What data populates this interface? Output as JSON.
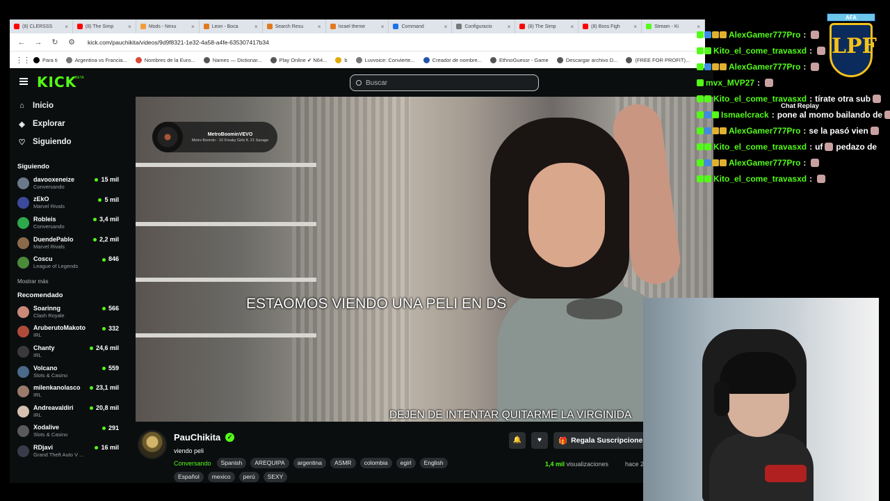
{
  "browser": {
    "tabs": [
      {
        "label": "(8) CLERSSS",
        "color": "#ff0000"
      },
      {
        "label": "(8) The Simp",
        "color": "#ff0000"
      },
      {
        "label": "Mods - Nexu",
        "color": "#f29d38"
      },
      {
        "label": "Leon - Boca",
        "color": "#e07a1f"
      },
      {
        "label": "Search Resu",
        "color": "#e07a1f"
      },
      {
        "label": "Israel theme",
        "color": "#e07a1f"
      },
      {
        "label": "Command",
        "color": "#1a73e8"
      },
      {
        "label": "Configuracio",
        "color": "#777777"
      },
      {
        "label": "(8) The Simp",
        "color": "#ff0000"
      },
      {
        "label": "(8) Boss Figh",
        "color": "#ff0000"
      },
      {
        "label": "Stream - Ki",
        "color": "#53fc18"
      }
    ],
    "url": "kick.com/pauchikita/videos/9d9f8321-1e32-4a58-a4fe-635307417b34",
    "bookmarks": [
      {
        "label": "Para ti",
        "color": "#000000"
      },
      {
        "label": "Argentina vs Francia...",
        "color": "#777777"
      },
      {
        "label": "Nombres de la Euro...",
        "color": "#d94a38"
      },
      {
        "label": "Names — Dictionar...",
        "color": "#555555"
      },
      {
        "label": "Play Online ✔ N64...",
        "color": "#555555"
      },
      {
        "label": "b",
        "color": "#e0a800"
      },
      {
        "label": "Luvvoice: Convierte...",
        "color": "#777777"
      },
      {
        "label": "Creador de nombre...",
        "color": "#2255aa"
      },
      {
        "label": "EthnoGuessr - Game",
        "color": "#555555"
      },
      {
        "label": "Descargar archivo D...",
        "color": "#555555"
      },
      {
        "label": "(FREE FOR PROFIT)...",
        "color": "#555555"
      }
    ]
  },
  "kick": {
    "logo": "KICK",
    "logo_beta": "BETA",
    "search_placeholder": "Buscar",
    "nav": [
      {
        "icon": "⌂",
        "label": "Inicio"
      },
      {
        "icon": "◈",
        "label": "Explorar"
      },
      {
        "icon": "♡",
        "label": "Siguiendo"
      }
    ],
    "following_title": "Siguiendo",
    "following": [
      {
        "name": "davooxeneize",
        "category": "Conversando",
        "viewers": "15 mil",
        "color": "#6b7a8a"
      },
      {
        "name": "zEkO",
        "category": "Marvel Rivals",
        "viewers": "5 mil",
        "color": "#3b4a9a"
      },
      {
        "name": "Robleis",
        "category": "Conversando",
        "viewers": "3,4 mil",
        "color": "#2da84a"
      },
      {
        "name": "DuendePablo",
        "category": "Marvel Rivals",
        "viewers": "2,2 mil",
        "color": "#8a6a4a"
      },
      {
        "name": "Coscu",
        "category": "League of Legends",
        "viewers": "846",
        "color": "#4a8a3a"
      }
    ],
    "show_more": "Mostrar más",
    "recommended_title": "Recomendado",
    "recommended": [
      {
        "name": "Soarinng",
        "category": "Clash Royale",
        "viewers": "566",
        "color": "#c98a7a"
      },
      {
        "name": "AruberutoMakoto",
        "category": "IRL",
        "viewers": "332",
        "color": "#b04a3a"
      },
      {
        "name": "Chanty",
        "category": "IRL",
        "viewers": "24,6 mil",
        "color": "#3a3a3a"
      },
      {
        "name": "Volcano",
        "category": "Slots & Casino",
        "viewers": "559",
        "color": "#4a6a8a"
      },
      {
        "name": "milenkanolasco",
        "category": "IRL",
        "viewers": "23,1 mil",
        "color": "#9a7a6a"
      },
      {
        "name": "Andreavaldiri",
        "category": "IRL",
        "viewers": "20,8 mil",
        "color": "#d8c0b0"
      },
      {
        "name": "Xodalive",
        "category": "Slots & Casino",
        "viewers": "291",
        "color": "#5a5a5a"
      },
      {
        "name": "RDjavi",
        "category": "Grand Theft Auto V ...",
        "viewers": "16 mil",
        "color": "#3a3a4a"
      }
    ],
    "video": {
      "song_artist": "MetroBoominVEVO",
      "song_title": "Metro Boomin - 10 Freaky Girls ft. 21 Savage",
      "caption_1": "ESTAOMOS VIENDO UNA PELI EN DS",
      "caption_2": "DEJEN DE INTENTAR QUITARME LA VIRGINIDA"
    },
    "channel": {
      "name": "PauChikita",
      "title": "viendo peli",
      "category": "Conversando",
      "tags_row1": [
        "Spanish",
        "AREQUIPA",
        "argentina",
        "ASMR",
        "colombia",
        "egirl",
        "English"
      ],
      "tags_row2": [
        "Español",
        "mexico",
        "perú",
        "SEXY"
      ],
      "views_count": "1,4 mil",
      "views_label": "visualizaciones",
      "ago": "hace 2",
      "gift_button": "Regala Suscripciones"
    }
  },
  "chat": {
    "replay_label": "Chat Replay",
    "messages": [
      {
        "user": "AlexGamer777Pro",
        "text": "",
        "badges": [
          "#53fc18",
          "#3a8de0",
          "#e0b030",
          "#e0b030"
        ]
      },
      {
        "user": "Kito_el_come_travasxd",
        "text": "",
        "badges": [
          "#53fc18",
          "#53fc18"
        ]
      },
      {
        "user": "AlexGamer777Pro",
        "text": "",
        "badges": [
          "#53fc18",
          "#3a8de0",
          "#e0b030",
          "#e0b030"
        ]
      },
      {
        "user": "mvx_MVP27",
        "text": "",
        "badges": [
          "#53fc18"
        ]
      },
      {
        "user": "Kito_el_come_travasxd",
        "text": "tírate otra sub",
        "badges": [
          "#53fc18",
          "#53fc18"
        ]
      },
      {
        "user": "Ismaelcrack",
        "text": "pone al momo bailando de",
        "badges": [
          "#53fc18",
          "#3a8de0",
          "#53fc18"
        ]
      },
      {
        "user": "AlexGamer777Pro",
        "text": "se la pasó vien",
        "badges": [
          "#53fc18",
          "#3a8de0",
          "#e0b030",
          "#e0b030"
        ]
      },
      {
        "user": "Kito_el_come_travasxd",
        "text": "uf",
        "badges": [
          "#53fc18",
          "#53fc18"
        ]
      },
      {
        "user": "AlexGamer777Pro",
        "text": "",
        "badges": [
          "#53fc18",
          "#3a8de0",
          "#e0b030",
          "#e0b030"
        ]
      },
      {
        "user": "Kito_el_come_travasxd",
        "text": "",
        "badges": [
          "#53fc18",
          "#53fc18"
        ]
      }
    ],
    "trailing_text": "pedazo de"
  },
  "logo": {
    "top": "AFA",
    "mark": "LPF"
  },
  "colors": {
    "kick_green": "#53fc18",
    "kick_bg": "#0b0e0f"
  }
}
